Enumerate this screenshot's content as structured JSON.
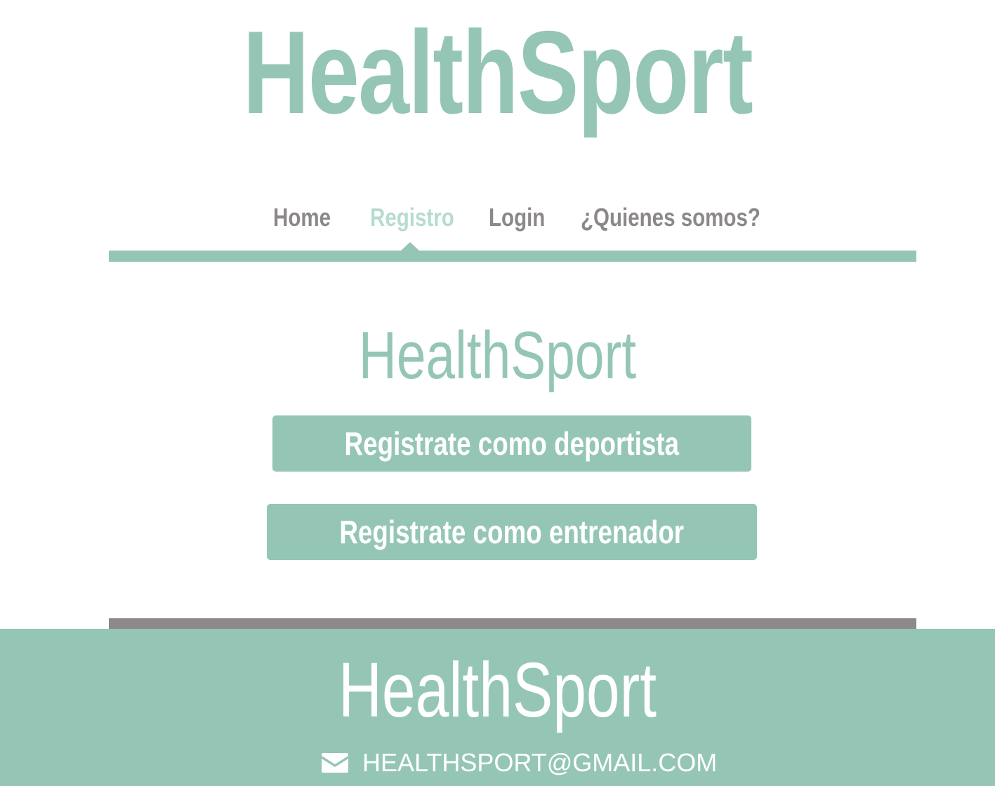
{
  "header": {
    "logo_text": "HealthSport"
  },
  "nav": {
    "items": [
      {
        "label": "Home",
        "active": false
      },
      {
        "label": "Registro",
        "active": true
      },
      {
        "label": "Login",
        "active": false
      },
      {
        "label": "¿Quienes somos?",
        "active": false
      }
    ]
  },
  "main": {
    "title": "HealthSport",
    "buttons": {
      "deportista": "Registrate como deportista",
      "entrenador": "Registrate como entrenador"
    }
  },
  "footer": {
    "title": "HealthSport",
    "email": "HEALTHSPORT@GMAIL.COM",
    "email_icon": "envelope-icon"
  },
  "colors": {
    "accent": "#95c6b5",
    "active_nav": "#b6dccf",
    "nav_text": "#8c8888",
    "divider_gray": "#8d8889",
    "white": "#ffffff"
  }
}
